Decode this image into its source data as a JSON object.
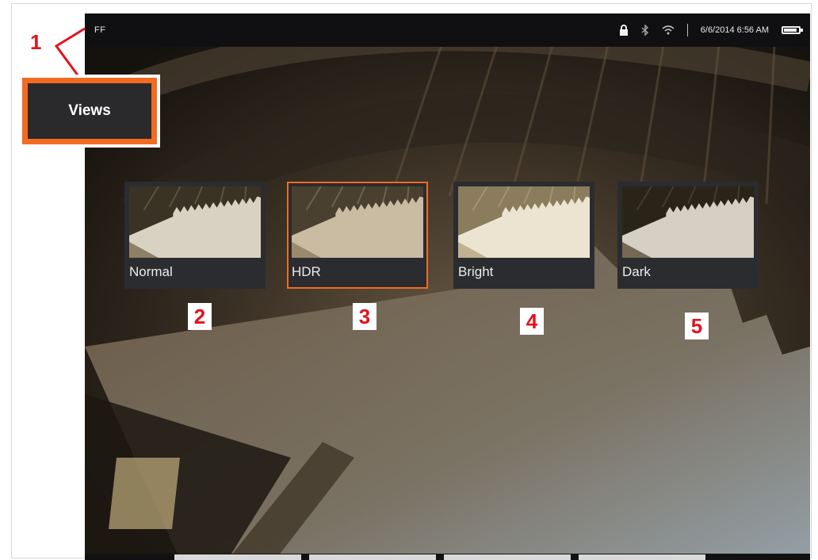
{
  "status_bar": {
    "mode": "FF",
    "datetime": "6/6/2014 6:56 AM",
    "icons": [
      "lock-icon",
      "bluetooth-icon",
      "wifi-icon",
      "battery-icon"
    ],
    "battery_level": 0.9
  },
  "menu": {
    "views_label": "Views"
  },
  "views": [
    {
      "label": "Normal",
      "selected": false
    },
    {
      "label": "HDR",
      "selected": true
    },
    {
      "label": "Bright",
      "selected": false
    },
    {
      "label": "Dark",
      "selected": false
    }
  ],
  "callouts": [
    "1",
    "2",
    "3",
    "4",
    "5"
  ],
  "colors": {
    "accent": "#f26b21",
    "callout": "#e3121b",
    "tile_bg": "#2b2c30",
    "status_bg": "#101012"
  }
}
